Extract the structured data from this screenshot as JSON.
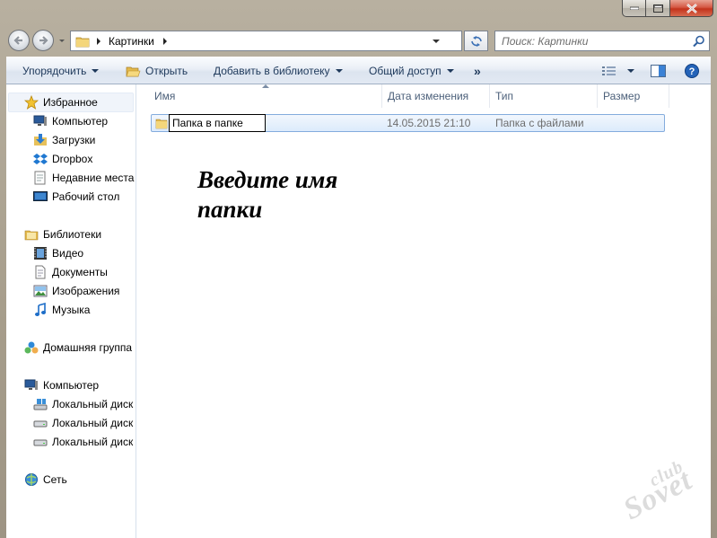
{
  "window": {
    "caption": {
      "minimize": "minimize",
      "maximize": "maximize",
      "close": "close"
    }
  },
  "address_bar": {
    "path": [
      "Картинки"
    ],
    "search_placeholder": "Поиск: Картинки"
  },
  "toolbar": {
    "organize": "Упорядочить",
    "open": "Открыть",
    "add_to_library": "Добавить в библиотеку",
    "share": "Общий доступ",
    "more": "»"
  },
  "nav": {
    "favorites": {
      "label": "Избранное",
      "items": [
        "Компьютер",
        "Загрузки",
        "Dropbox",
        "Недавние места",
        "Рабочий стол"
      ]
    },
    "libraries": {
      "label": "Библиотеки",
      "items": [
        "Видео",
        "Документы",
        "Изображения",
        "Музыка"
      ]
    },
    "homegroup": {
      "label": "Домашняя группа"
    },
    "computer": {
      "label": "Компьютер",
      "items": [
        "Локальный диск",
        "Локальный диск",
        "Локальный диск"
      ]
    },
    "network": {
      "label": "Сеть"
    }
  },
  "columns": {
    "name": "Имя",
    "date": "Дата изменения",
    "type": "Тип",
    "size": "Размер"
  },
  "files": [
    {
      "name": "Папка в папке",
      "date": "14.05.2015 21:10",
      "type": "Папка с файлами",
      "size": ""
    }
  ],
  "annotation": {
    "line1": "Введите имя",
    "line2": "папки"
  },
  "watermark": {
    "line1": "club",
    "line2": "Sovet"
  },
  "colors": {
    "accent": "#1e395b",
    "selection": "#dcebfc",
    "selection_border": "#84acdd"
  }
}
